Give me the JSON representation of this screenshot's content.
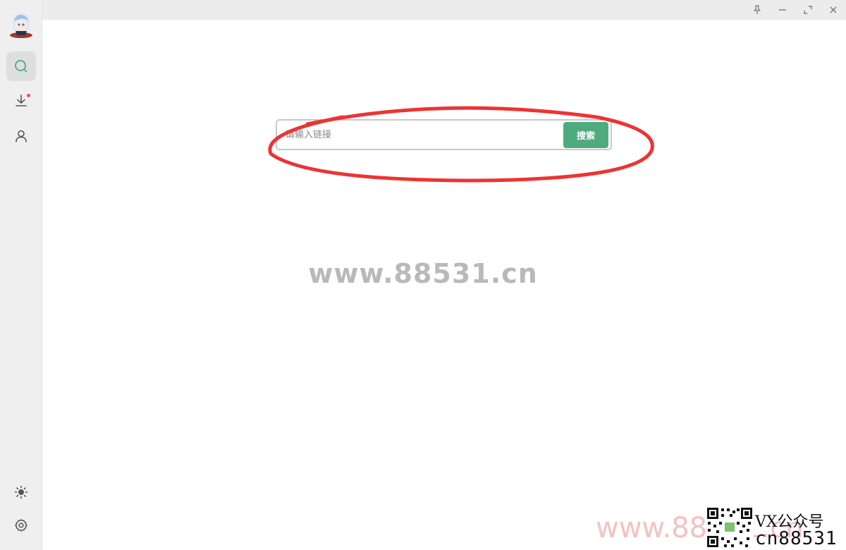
{
  "search": {
    "placeholder": "请输入链接",
    "button_label": "搜索"
  },
  "sidebar": {
    "items": [
      {
        "name": "search",
        "active": true
      },
      {
        "name": "download",
        "has_badge": true
      },
      {
        "name": "user"
      }
    ],
    "bottom_items": [
      {
        "name": "theme"
      },
      {
        "name": "settings"
      }
    ]
  },
  "watermark": {
    "center": "www.88531.cn",
    "bottom_url": "www.88531.cn",
    "vx_label": "VX公众号",
    "cn_label": "cn88531"
  },
  "colors": {
    "accent": "#4eab7e",
    "badge": "#f0524f",
    "annotation": "#ee3333"
  }
}
